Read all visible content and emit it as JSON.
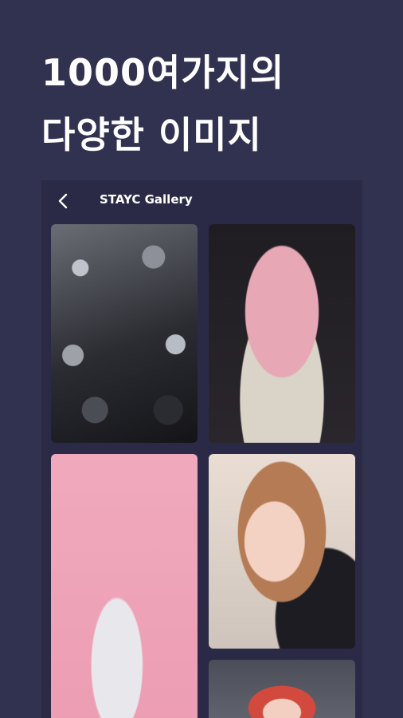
{
  "promo": {
    "headline_line1": "1000여가지의",
    "headline_line2": "다양한 이미지"
  },
  "appbar": {
    "back_icon": "chevron-left-icon",
    "title": "STAYC Gallery"
  },
  "gallery": {
    "items": [
      {
        "name": "gallery-photo-1"
      },
      {
        "name": "gallery-photo-2"
      },
      {
        "name": "gallery-photo-3"
      },
      {
        "name": "gallery-photo-4"
      },
      {
        "name": "gallery-photo-5"
      }
    ]
  },
  "colors": {
    "background": "#313150",
    "panel": "#2a2a46",
    "text": "#ffffff"
  }
}
